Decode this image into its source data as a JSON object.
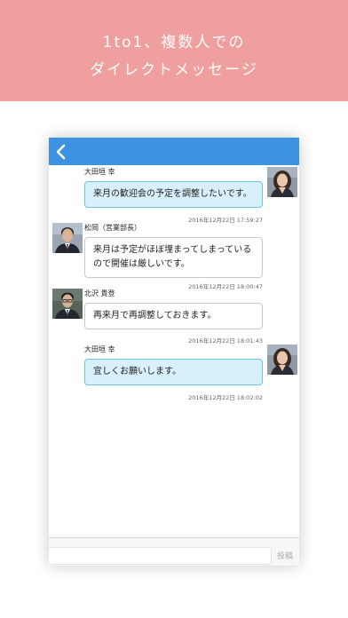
{
  "banner": {
    "line1": "1to1、複数人での",
    "line2": "ダイレクトメッセージ",
    "color": "#ef9f9e"
  },
  "navbar": {
    "color": "#3d92e1",
    "back_icon": "chevron-left-icon"
  },
  "messages": [
    {
      "sender": "大田垣 幸",
      "text": "来月の歓迎会の予定を調整したいです。",
      "timestamp": "2016年12月22日 17:59:27",
      "mine": true
    },
    {
      "sender": "松岡（営業部長）",
      "text": "来月は予定がほぼ埋まってしまっているので開催は厳しいです。",
      "timestamp": "2016年12月22日 18:00:47",
      "mine": false
    },
    {
      "sender": "北沢 貴登",
      "text": "再来月で再調整しておきます。",
      "timestamp": "2016年12月22日 18:01:43",
      "mine": false
    },
    {
      "sender": "大田垣 幸",
      "text": "宜しくお願いします。",
      "timestamp": "2016年12月22日 18:02:02",
      "mine": true
    }
  ],
  "composer": {
    "input_value": "",
    "post_label": "投稿"
  }
}
